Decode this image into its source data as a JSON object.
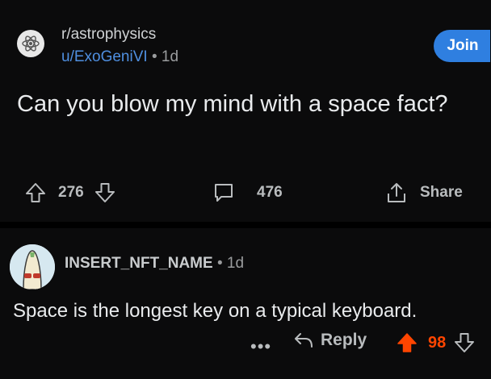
{
  "post": {
    "subreddit": "r/astrophysics",
    "author": "u/ExoGeniVI",
    "separator": "•",
    "age": "1d",
    "join_label": "Join",
    "title": "Can you blow my mind with a space fact?",
    "upvotes": "276",
    "comments": "476",
    "share_label": "Share"
  },
  "comment": {
    "author": "INSERT_NFT_NAME",
    "separator": "•",
    "age": "1d",
    "body": "Space is the longest key on a typical keyboard.",
    "more_label": "•••",
    "reply_label": "Reply",
    "votes": "98",
    "vote_color": "#ff4500"
  },
  "colors": {
    "accent": "#2f7fe0",
    "username": "#4f8fe0",
    "upvote_active": "#ff4500"
  }
}
